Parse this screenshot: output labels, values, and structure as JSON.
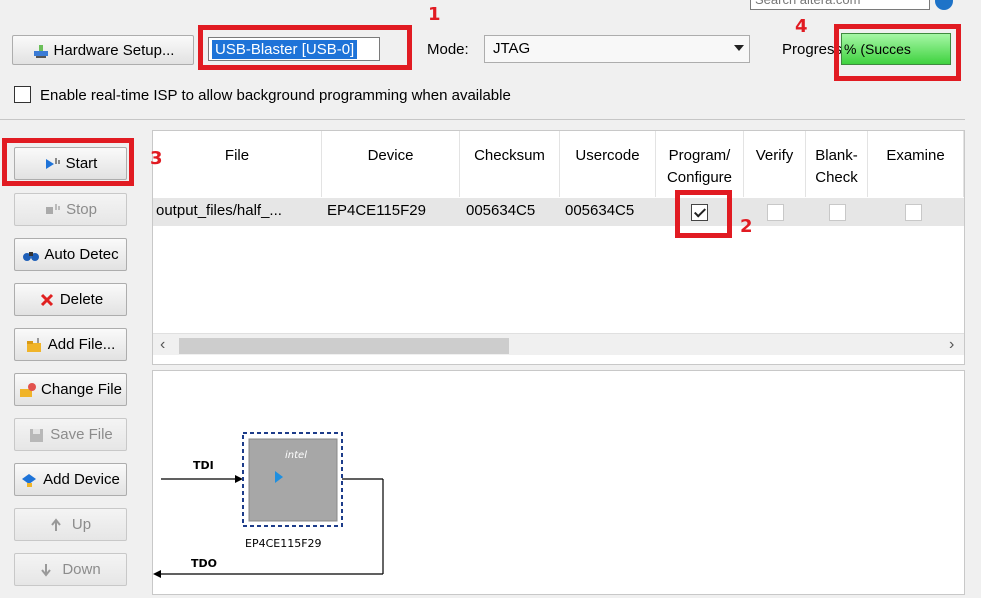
{
  "search": {
    "placeholder": "Search altera.com"
  },
  "toolbar": {
    "hardware_button": "Hardware Setup...",
    "hardware_value": "USB-Blaster [USB-0]",
    "mode_label": "Mode:",
    "mode_value": "JTAG",
    "progress_label": "Progress:",
    "progress_text": "% (Succes",
    "isp_label": "Enable real-time ISP to allow background programming when available",
    "isp_checked": false
  },
  "sidebar": {
    "start": "Start",
    "stop": "Stop",
    "auto_detect": "Auto Detec",
    "delete": "Delete",
    "add_file": "Add File...",
    "change_file": "Change File",
    "save_file": "Save File",
    "add_device": "Add Device",
    "up": "Up",
    "down": "Down"
  },
  "table": {
    "headers": [
      "File",
      "Device",
      "Checksum",
      "Usercode",
      "Program/ Configure",
      "Verify",
      "Blank- Check",
      "Examine"
    ],
    "rows": [
      {
        "file": "output_files/half_...",
        "device": "EP4CE115F29",
        "checksum": "005634C5",
        "usercode": "005634C5",
        "program": true,
        "verify": false,
        "blank_check": false,
        "examine": false
      }
    ]
  },
  "chain": {
    "tdi": "TDI",
    "tdo": "TDO",
    "device_name": "EP4CE115F29",
    "chip_logo": "intel"
  },
  "annotations": [
    "1",
    "2",
    "3",
    "4"
  ],
  "colors": {
    "annotation": "#e11b22",
    "selection": "#1e73d8",
    "progress": "#3fd23f"
  }
}
